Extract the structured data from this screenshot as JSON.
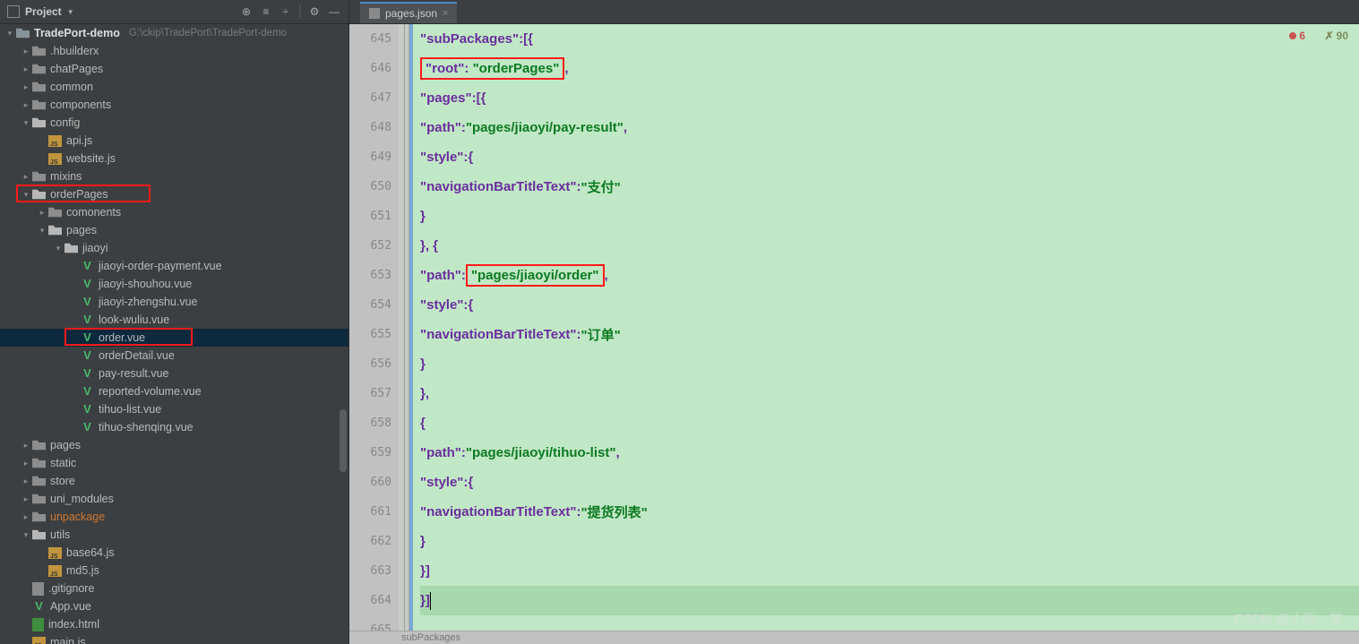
{
  "project_panel": {
    "title": "Project"
  },
  "project_root": {
    "name": "TradePort-demo",
    "path": "G:\\ckip\\TradePort\\TradePort-demo"
  },
  "tree": [
    {
      "d": 1,
      "a": "right",
      "i": "folder",
      "n": ".hbuilderx"
    },
    {
      "d": 1,
      "a": "right",
      "i": "folder",
      "n": "chatPages"
    },
    {
      "d": 1,
      "a": "right",
      "i": "folder",
      "n": "common"
    },
    {
      "d": 1,
      "a": "right",
      "i": "folder",
      "n": "components"
    },
    {
      "d": 1,
      "a": "down",
      "i": "folder-open",
      "n": "config"
    },
    {
      "d": 2,
      "a": "none",
      "i": "js",
      "n": "api.js"
    },
    {
      "d": 2,
      "a": "none",
      "i": "js",
      "n": "website.js"
    },
    {
      "d": 1,
      "a": "right",
      "i": "folder",
      "n": "mixins"
    },
    {
      "d": 1,
      "a": "down",
      "i": "folder-open",
      "n": "orderPages",
      "red": true
    },
    {
      "d": 2,
      "a": "right",
      "i": "folder",
      "n": "comonents"
    },
    {
      "d": 2,
      "a": "down",
      "i": "folder-open",
      "n": "pages"
    },
    {
      "d": 3,
      "a": "down",
      "i": "folder-open",
      "n": "jiaoyi"
    },
    {
      "d": 4,
      "a": "none",
      "i": "vue",
      "n": "jiaoyi-order-payment.vue"
    },
    {
      "d": 4,
      "a": "none",
      "i": "vue",
      "n": "jiaoyi-shouhou.vue"
    },
    {
      "d": 4,
      "a": "none",
      "i": "vue",
      "n": "jiaoyi-zhengshu.vue"
    },
    {
      "d": 4,
      "a": "none",
      "i": "vue",
      "n": "look-wuliu.vue"
    },
    {
      "d": 4,
      "a": "none",
      "i": "vue",
      "n": "order.vue",
      "sel": true,
      "red": true
    },
    {
      "d": 4,
      "a": "none",
      "i": "vue",
      "n": "orderDetail.vue"
    },
    {
      "d": 4,
      "a": "none",
      "i": "vue",
      "n": "pay-result.vue"
    },
    {
      "d": 4,
      "a": "none",
      "i": "vue",
      "n": "reported-volume.vue"
    },
    {
      "d": 4,
      "a": "none",
      "i": "vue",
      "n": "tihuo-list.vue"
    },
    {
      "d": 4,
      "a": "none",
      "i": "vue",
      "n": "tihuo-shenqing.vue"
    },
    {
      "d": 1,
      "a": "right",
      "i": "folder",
      "n": "pages"
    },
    {
      "d": 1,
      "a": "right",
      "i": "folder",
      "n": "static"
    },
    {
      "d": 1,
      "a": "right",
      "i": "folder",
      "n": "store"
    },
    {
      "d": 1,
      "a": "right",
      "i": "folder",
      "n": "uni_modules"
    },
    {
      "d": 1,
      "a": "right",
      "i": "folder",
      "n": "unpackage",
      "orange": true
    },
    {
      "d": 1,
      "a": "down",
      "i": "folder-open",
      "n": "utils"
    },
    {
      "d": 2,
      "a": "none",
      "i": "js",
      "n": "base64.js"
    },
    {
      "d": 2,
      "a": "none",
      "i": "js",
      "n": "md5.js"
    },
    {
      "d": 1,
      "a": "none",
      "i": "file",
      "n": ".gitignore"
    },
    {
      "d": 1,
      "a": "none",
      "i": "vue",
      "n": "App.vue"
    },
    {
      "d": 1,
      "a": "none",
      "i": "html",
      "n": "index.html"
    },
    {
      "d": 1,
      "a": "none",
      "i": "js",
      "n": "main.js"
    }
  ],
  "tab": {
    "label": "pages.json"
  },
  "lines": {
    "start": 645,
    "end": 665
  },
  "code": {
    "l645": "\"subPackages\": [{",
    "l646_k": "\"root\"",
    "l646_v": "\"orderPages\"",
    "l647": "\"pages\": [{",
    "l648_k": "\"path\"",
    "l648_v": "\"pages/jiaoyi/pay-result\"",
    "l649": "\"style\": {",
    "l650_k": "\"navigationBarTitleText\"",
    "l650_v": "\"支付\"",
    "l651": "}",
    "l652": "}, {",
    "l653_k": "\"path\"",
    "l653_v": "\"pages/jiaoyi/order\"",
    "l654": "\"style\": {",
    "l655_k": "\"navigationBarTitleText\"",
    "l655_v": "\"订单\"",
    "l656": "}",
    "l657": "},",
    "l658": "{",
    "l659_k": "\"path\"",
    "l659_v": "\"pages/jiaoyi/tihuo-list\"",
    "l660": "\"style\": {",
    "l661_k": "\"navigationBarTitleText\"",
    "l661_v": "\"提货列表\"",
    "l662": "}",
    "l663": "}]",
    "l664": "}]",
    "l665": ""
  },
  "badges": {
    "err": "6",
    "warn": "90"
  },
  "status_text": "subPackages",
  "watermark": "CSDN @丿乐…学"
}
